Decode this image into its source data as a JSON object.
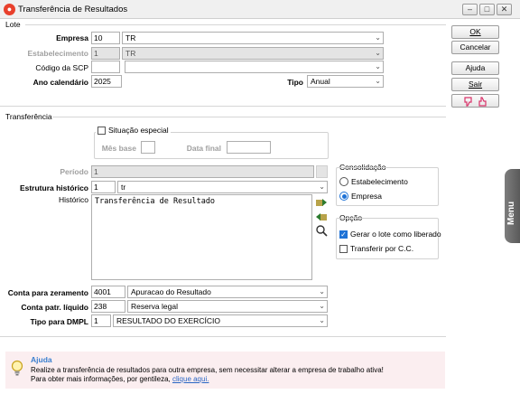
{
  "window": {
    "title": "Transferência de Resultados",
    "app_icon": "app-logo-icon"
  },
  "lote": {
    "group_label": "Lote",
    "empresa": {
      "label": "Empresa",
      "code": "10",
      "name": "TR"
    },
    "estabelecimento": {
      "label": "Estabelecimento",
      "code": "1",
      "name": "TR"
    },
    "codigo_scp": {
      "label": "Código da SCP",
      "code": "",
      "name": ""
    },
    "ano_calendario": {
      "label": "Ano calendário",
      "value": "2025"
    },
    "tipo": {
      "label": "Tipo",
      "value": "Anual"
    }
  },
  "buttons": {
    "ok": "OK",
    "cancelar": "Cancelar",
    "ajuda": "Ajuda",
    "sair": "Sair"
  },
  "transferencia": {
    "group_label": "Transferência",
    "situacao_especial": {
      "label": "Situação especial",
      "checked": false
    },
    "mes_base": {
      "label": "Mês base",
      "value": ""
    },
    "data_final": {
      "label": "Data final",
      "value": ""
    },
    "periodo": {
      "label": "Período",
      "value": "1"
    },
    "estrutura_historico": {
      "label": "Estrutura histórico",
      "code": "1",
      "name": "tr"
    },
    "historico": {
      "label": "Histórico",
      "text": "Transferência de Resultado"
    },
    "conta_zeramento": {
      "label": "Conta para zeramento",
      "code": "4001",
      "name": "Apuracao do Resultado"
    },
    "conta_patr_liquido": {
      "label": "Conta patr. líquido",
      "code": "238",
      "name": "Reserva legal"
    },
    "tipo_dmpl": {
      "label": "Tipo para DMPL",
      "code": "1",
      "name": "RESULTADO DO EXERCÍCIO"
    }
  },
  "consolidacao": {
    "label": "Consolidação",
    "options": [
      "Estabelecimento",
      "Empresa"
    ],
    "selected": "Empresa"
  },
  "opcao": {
    "label": "Opção",
    "gerar_lote": {
      "label": "Gerar o lote como liberado",
      "checked": true
    },
    "transferir_cc": {
      "label": "Transferir por C.C.",
      "checked": false
    }
  },
  "side_tab": {
    "label": "Menu"
  },
  "help": {
    "title": "Ajuda",
    "line1": "Realize a transferência de resultados para outra empresa, sem necessitar alterar a empresa de trabalho ativa!",
    "line2_prefix": "Para obter mais informações, por gentileza,",
    "link": "clique aqui."
  },
  "colors": {
    "accent_blue": "#1e72d6",
    "help_background": "#fbeef0",
    "help_title": "#3a7fcf",
    "thumb_icon": "#d9336a",
    "app_icon": "#e8402c"
  }
}
